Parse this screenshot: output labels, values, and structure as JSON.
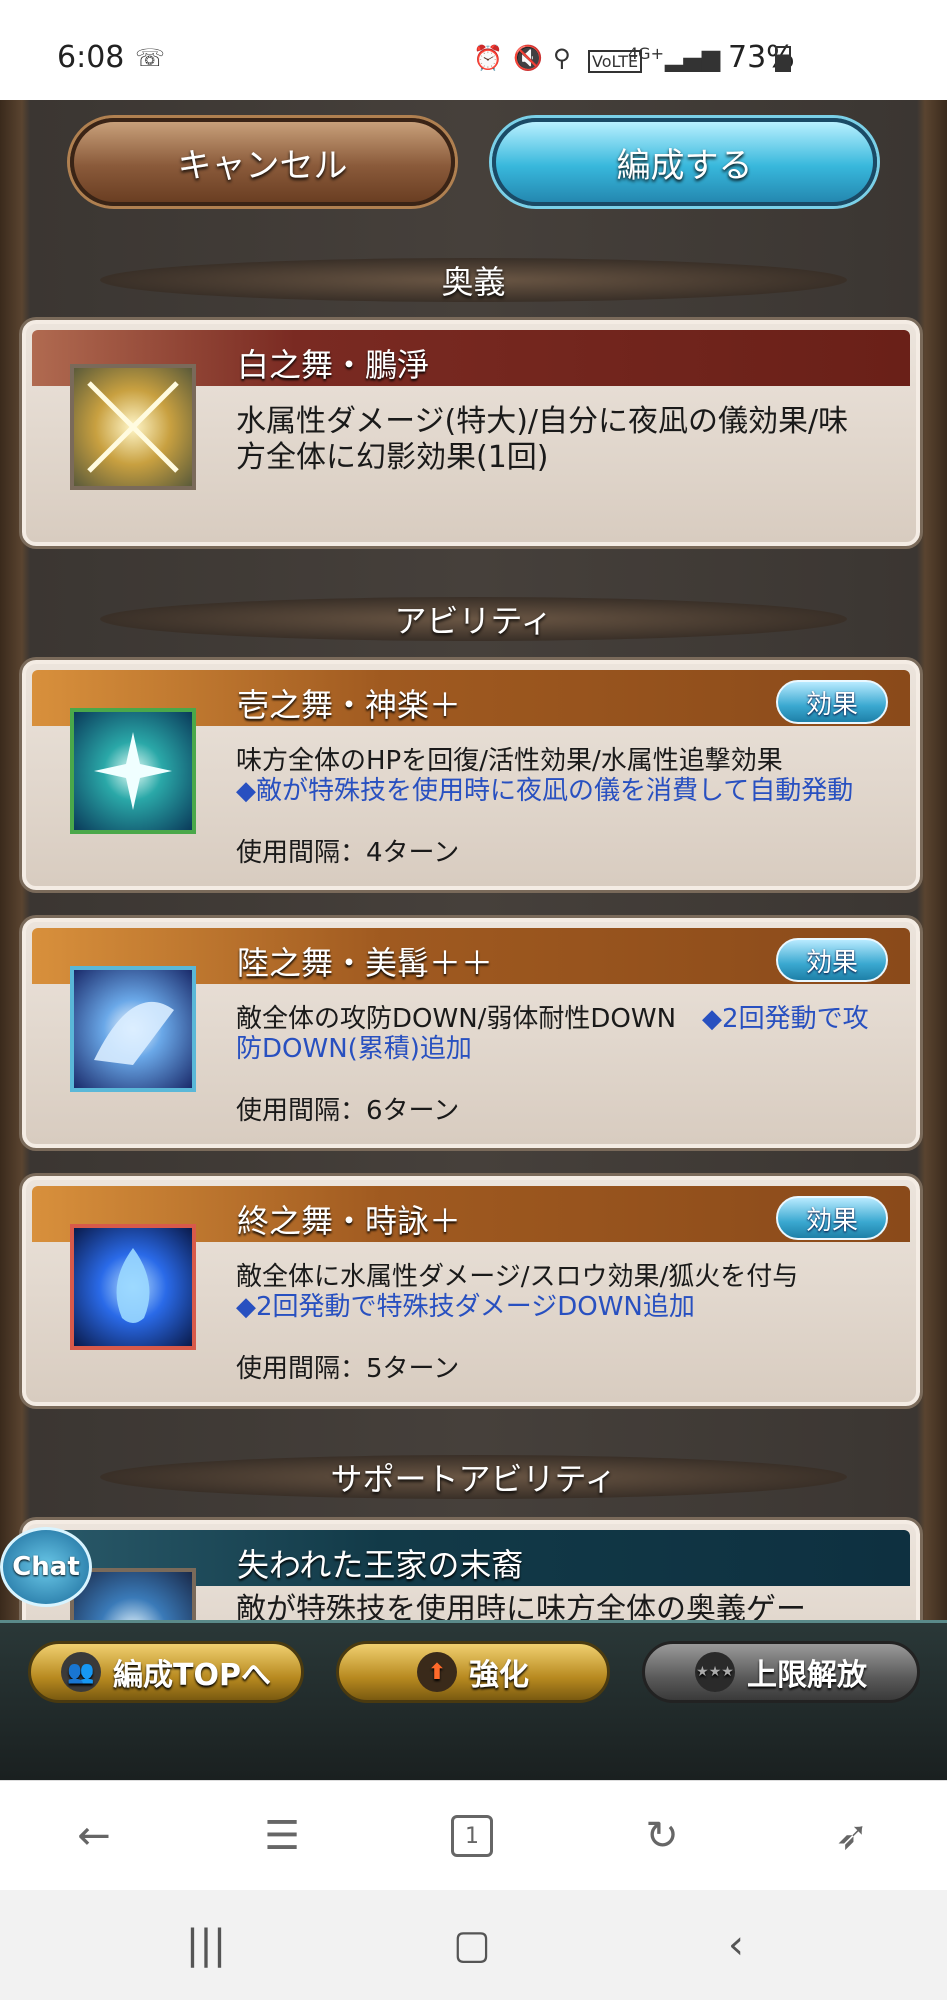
{
  "status_bar": {
    "time": "6:08",
    "battery": "73%"
  },
  "header": {
    "cancel_label": "キャンセル",
    "confirm_label": "編成する"
  },
  "sections": {
    "ougi": "奥義",
    "abilities": "アビリティ",
    "support": "サポートアビリティ"
  },
  "ougi_card": {
    "title": "白之舞・鵬淨",
    "desc": "水属性ダメージ(特大)/自分に夜凪の儀効果/味方全体に幻影効果(1回)"
  },
  "effect_label": "効果",
  "abilities": [
    {
      "title": "壱之舞・神楽＋",
      "desc": "味方全体のHPを回復/活性効果/水属性追撃効果",
      "note": "◆敵が特殊技を使用時に夜凪の儀を消費して自動発動",
      "cooldown": "使用間隔：4ターン"
    },
    {
      "title": "陸之舞・美髯＋＋",
      "desc": "敵全体の攻防DOWN/弱体耐性DOWN　",
      "note": "◆2回発動で攻防DOWN(累積)追加",
      "cooldown": "使用間隔：6ターン"
    },
    {
      "title": "終之舞・時詠＋",
      "desc": "敵全体に水属性ダメージ/スロウ効果/狐火を付与",
      "note": "◆2回発動で特殊技ダメージDOWN追加",
      "cooldown": "使用間隔：5ターン"
    }
  ],
  "support_card": {
    "title": "失われた王家の末裔",
    "desc": "敵が特殊技を使用時に味方全体の奥義ゲー"
  },
  "chat_label": "Chat",
  "game_bar": {
    "formation_top": "編成TOPへ",
    "enhance": "強化",
    "limit_break": "上限解放"
  },
  "browser_toolbar": {
    "tab_count": "1"
  },
  "icons": [
    "back-icon",
    "menu-icon",
    "tabs-icon",
    "refresh-icon",
    "rocket-icon",
    "recent-apps-icon",
    "home-icon",
    "nav-back-icon"
  ]
}
